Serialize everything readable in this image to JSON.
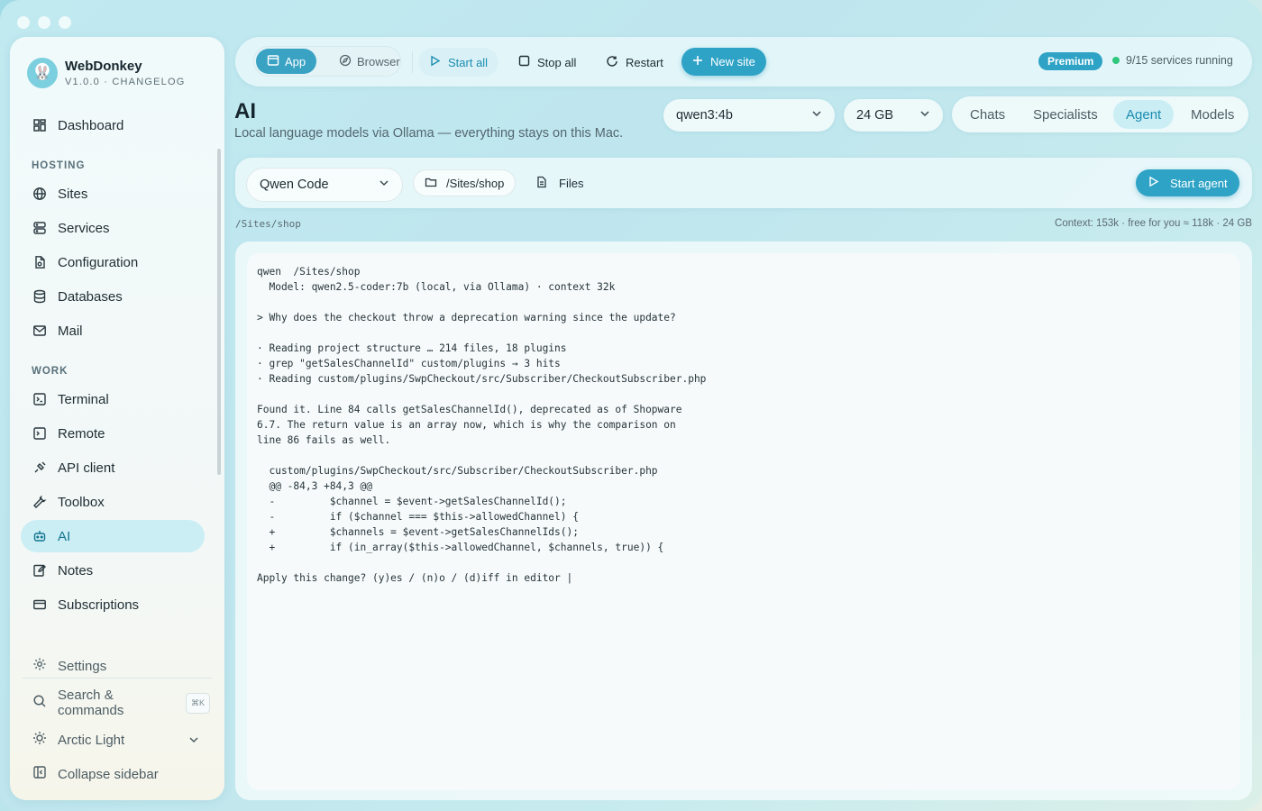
{
  "brand": {
    "name": "WebDonkey",
    "sub": "V1.0.0 · CHANGELOG"
  },
  "sidebar": {
    "sections": {
      "hosting": "HOSTING",
      "work": "WORK"
    },
    "items": [
      {
        "label": "Dashboard",
        "icon": "dashboard-icon"
      },
      {
        "label": "Sites",
        "icon": "globe-icon"
      },
      {
        "label": "Services",
        "icon": "server-icon"
      },
      {
        "label": "Configuration",
        "icon": "config-file-icon"
      },
      {
        "label": "Databases",
        "icon": "database-icon"
      },
      {
        "label": "Mail",
        "icon": "mail-icon"
      },
      {
        "label": "Terminal",
        "icon": "terminal-icon"
      },
      {
        "label": "Remote",
        "icon": "remote-icon"
      },
      {
        "label": "API client",
        "icon": "api-icon"
      },
      {
        "label": "Toolbox",
        "icon": "wrench-icon"
      },
      {
        "label": "AI",
        "icon": "robot-icon",
        "active": true
      },
      {
        "label": "Notes",
        "icon": "notes-icon"
      },
      {
        "label": "Subscriptions",
        "icon": "card-icon"
      }
    ],
    "footer": {
      "settings": "Settings",
      "search": "Search & commands",
      "search_kbd": "⌘K",
      "theme": "Arctic Light",
      "collapse": "Collapse sidebar"
    }
  },
  "topbar": {
    "app": "App",
    "browser": "Browser",
    "start_all": "Start all",
    "stop_all": "Stop all",
    "restart": "Restart",
    "new_site": "New site",
    "premium": "Premium",
    "status": "9/15 services running"
  },
  "header": {
    "title": "AI",
    "subtitle": "Local language models via Ollama — everything stays on this Mac.",
    "model": "qwen3:4b",
    "memory": "24 GB",
    "tabs": [
      "Chats",
      "Specialists",
      "Agent",
      "Models"
    ],
    "active_tab": "Agent"
  },
  "agent": {
    "tool": "Qwen Code",
    "path": "/Sites/shop",
    "files": "Files",
    "start": "Start agent",
    "path_label": "/Sites/shop",
    "context": "Context: 153k · free for you ≈ 118k · 24 GB"
  },
  "terminal": {
    "lines": [
      "qwen  /Sites/shop",
      "  Model: qwen2.5-coder:7b (local, via Ollama) · context 32k",
      "",
      "> Why does the checkout throw a deprecation warning since the update?",
      "",
      "· Reading project structure … 214 files, 18 plugins",
      "· grep \"getSalesChannelId\" custom/plugins → 3 hits",
      "· Reading custom/plugins/SwpCheckout/src/Subscriber/CheckoutSubscriber.php",
      "",
      "Found it. Line 84 calls getSalesChannelId(), deprecated as of Shopware",
      "6.7. The return value is an array now, which is why the comparison on",
      "line 86 fails as well.",
      "",
      "  custom/plugins/SwpCheckout/src/Subscriber/CheckoutSubscriber.php",
      "  @@ -84,3 +84,3 @@",
      "  -         $channel = $event->getSalesChannelId();",
      "  -         if ($channel === $this->allowedChannel) {",
      "  +         $channels = $event->getSalesChannelIds();",
      "  +         if (in_array($this->allowedChannel, $channels, true)) {",
      "",
      "Apply this change? (y)es / (n)o / (d)iff in editor |"
    ]
  }
}
